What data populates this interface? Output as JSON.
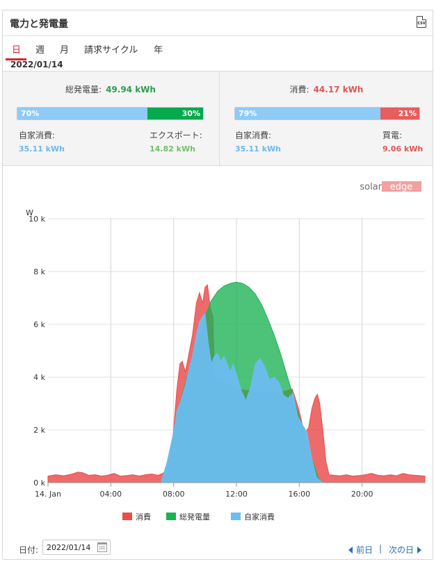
{
  "header": {
    "title": "電力と発電量",
    "csv_icon_text": "CSV"
  },
  "tabs": [
    {
      "label": "日",
      "active": true
    },
    {
      "label": "週",
      "active": false
    },
    {
      "label": "月",
      "active": false
    },
    {
      "label": "請求サイクル",
      "active": false
    },
    {
      "label": "年",
      "active": false
    }
  ],
  "date": "2022/01/14",
  "production": {
    "label": "総発電量:",
    "value": "49.94 kWh",
    "bar_left_pct": "70%",
    "bar_right_pct": "30%",
    "bar_left_fraction": 0.7,
    "left_label": "自家消費:",
    "left_value": "35.11 kWh",
    "right_label": "エクスポート:",
    "right_value": "14.82 kWh"
  },
  "consumption": {
    "label": "消費:",
    "value": "44.17 kWh",
    "bar_left_pct": "79%",
    "bar_right_pct": "21%",
    "bar_left_fraction": 0.79,
    "left_label": "自家消費:",
    "left_value": "35.11 kWh",
    "right_label": "買電:",
    "right_value": "9.06 kWh"
  },
  "logo": {
    "text_a": "solar",
    "text_b": "edge"
  },
  "colors": {
    "consumption": "#ea4b4b",
    "production": "#1bb254",
    "self_consumption": "#6cbdf3",
    "accent": "#d9252a",
    "link": "#2a6fb5"
  },
  "chart_data": {
    "type": "area",
    "ylabel": "W",
    "ylim": [
      0,
      10000
    ],
    "yticks": [
      {
        "value": 0,
        "label": "0 k"
      },
      {
        "value": 2000,
        "label": "2 k"
      },
      {
        "value": 4000,
        "label": "4 k"
      },
      {
        "value": 6000,
        "label": "6 k"
      },
      {
        "value": 8000,
        "label": "8 k"
      },
      {
        "value": 10000,
        "label": "10 k"
      }
    ],
    "xlim": [
      0,
      24
    ],
    "xticks": [
      {
        "value": 0,
        "label": "14. Jan"
      },
      {
        "value": 4,
        "label": "04:00"
      },
      {
        "value": 8,
        "label": "08:00"
      },
      {
        "value": 12,
        "label": "12:00"
      },
      {
        "value": 16,
        "label": "16:00"
      },
      {
        "value": 20,
        "label": "20:00"
      }
    ],
    "legend_position": "bottom",
    "series": [
      {
        "name": "消費",
        "color": "#ea4b4b",
        "x": [
          0,
          0.5,
          1,
          1.5,
          1.9,
          2.2,
          2.6,
          3,
          3.4,
          3.8,
          4.2,
          4.6,
          5,
          5.4,
          5.8,
          6.2,
          6.6,
          7,
          7.3,
          7.6,
          7.8,
          8,
          8.2,
          8.4,
          8.55,
          8.75,
          8.95,
          9.2,
          9.45,
          9.65,
          9.85,
          10,
          10.15,
          10.35,
          10.5,
          10.6,
          10.8,
          11,
          11.5,
          12,
          12.5,
          13,
          13.5,
          14,
          14.5,
          15,
          15.3,
          15.55,
          15.8,
          16,
          16.2,
          16.4,
          16.6,
          16.8,
          17,
          17.15,
          17.3,
          17.5,
          17.7,
          17.9,
          18.2,
          18.6,
          19,
          19.4,
          19.8,
          20.2,
          20.6,
          21,
          21.4,
          21.8,
          22.2,
          22.6,
          23,
          23.4,
          23.8,
          24
        ],
        "y": [
          250,
          300,
          260,
          320,
          400,
          380,
          280,
          300,
          250,
          280,
          350,
          250,
          270,
          300,
          250,
          300,
          330,
          280,
          350,
          500,
          1000,
          2000,
          3500,
          4500,
          4600,
          4200,
          4800,
          5600,
          6800,
          7200,
          6800,
          7400,
          7500,
          6600,
          6300,
          4000,
          3800,
          3900,
          3700,
          3600,
          3500,
          3500,
          3450,
          3400,
          3400,
          3450,
          3500,
          3550,
          3100,
          2700,
          2200,
          1900,
          2100,
          2800,
          3200,
          3350,
          3000,
          2000,
          800,
          300,
          280,
          260,
          300,
          250,
          270,
          300,
          350,
          280,
          260,
          300,
          260,
          350,
          300,
          280,
          260,
          250
        ]
      },
      {
        "name": "総発電量",
        "color": "#1bb254",
        "x": [
          7.2,
          7.6,
          8,
          8.4,
          8.8,
          9.2,
          9.6,
          10,
          10.4,
          10.8,
          11.2,
          11.6,
          12,
          12.4,
          12.8,
          13.2,
          13.6,
          14,
          14.4,
          14.8,
          15.2,
          15.6,
          16,
          16.4,
          16.8,
          17.2,
          17.5
        ],
        "y": [
          0,
          800,
          1900,
          3000,
          3900,
          4700,
          5500,
          6300,
          6900,
          7250,
          7450,
          7550,
          7600,
          7550,
          7400,
          7150,
          6750,
          6200,
          5600,
          4900,
          4100,
          3300,
          2500,
          1700,
          900,
          200,
          0
        ]
      },
      {
        "name": "自家消費",
        "color": "#6cbdf3",
        "x": [
          7.2,
          7.6,
          8,
          8.2,
          8.4,
          8.55,
          8.75,
          8.95,
          9.2,
          9.45,
          9.65,
          9.85,
          10,
          10.2,
          10.4,
          10.6,
          10.8,
          11,
          11.2,
          11.4,
          11.6,
          11.8,
          12,
          12.3,
          12.6,
          12.9,
          13.2,
          13.5,
          13.8,
          14.1,
          14.4,
          14.7,
          15,
          15.3,
          15.6,
          15.9,
          16.2,
          16.5,
          16.8,
          17.1,
          17.5
        ],
        "y": [
          0,
          800,
          1900,
          2700,
          3000,
          3300,
          3700,
          4200,
          4800,
          5600,
          6100,
          6300,
          6400,
          5300,
          4500,
          4800,
          4900,
          4600,
          4800,
          4500,
          4200,
          4500,
          4100,
          3500,
          3100,
          3600,
          4500,
          4700,
          4400,
          3900,
          4000,
          3800,
          3300,
          3200,
          3400,
          2500,
          2200,
          1900,
          900,
          200,
          0
        ]
      }
    ]
  },
  "footer": {
    "date_label": "日付:",
    "date_value": "2022/01/14",
    "prev_label": "前日",
    "separator": "|",
    "next_label": "次の日"
  }
}
